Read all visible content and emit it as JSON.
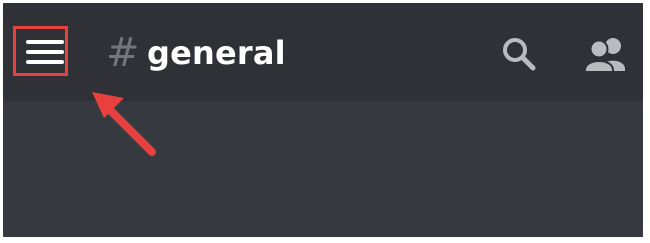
{
  "header": {
    "channel_name": "general"
  },
  "icons": {
    "menu": "hamburger-menu-icon",
    "channel": "hash-icon",
    "search": "search-icon",
    "members": "members-icon"
  },
  "colors": {
    "header_background": "#2f3136",
    "content_background": "#36393f",
    "accent_annotation": "#e8413d",
    "text_primary": "#ffffff",
    "icon_muted": "#b9bbbe",
    "hash_color": "#72767d"
  }
}
